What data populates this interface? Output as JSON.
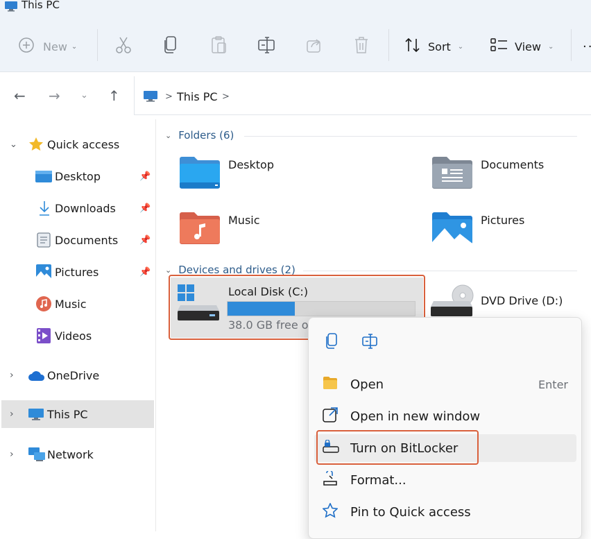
{
  "window": {
    "title": "This PC"
  },
  "toolbar": {
    "new_label": "New",
    "sort_label": "Sort",
    "view_label": "View",
    "icons": [
      "plus-circle-icon",
      "cut-icon",
      "copy-icon",
      "paste-icon",
      "rename-icon",
      "share-icon",
      "delete-icon",
      "sort-icon",
      "view-icon",
      "more-icon"
    ]
  },
  "address": {
    "crumbs": [
      "This PC"
    ],
    "separator": ">"
  },
  "sidebar": {
    "quick_access": "Quick access",
    "items": [
      {
        "label": "Desktop",
        "icon": "desktop-icon"
      },
      {
        "label": "Downloads",
        "icon": "download-icon"
      },
      {
        "label": "Documents",
        "icon": "documents-icon"
      },
      {
        "label": "Pictures",
        "icon": "pictures-icon"
      },
      {
        "label": "Music",
        "icon": "music-icon"
      },
      {
        "label": "Videos",
        "icon": "videos-icon"
      }
    ],
    "onedrive": "OneDrive",
    "this_pc": "This PC",
    "network": "Network"
  },
  "main": {
    "folders_header": "Folders (6)",
    "folders": [
      "Desktop",
      "Documents",
      "Music",
      "Pictures"
    ],
    "drives_header": "Devices and drives (2)",
    "drive_c": {
      "name": "Local Disk (C:)",
      "free_text": "38.0 GB free of",
      "used_fraction": 0.36
    },
    "drive_d": {
      "name": "DVD Drive (D:)"
    }
  },
  "context_menu": {
    "items": [
      {
        "label": "Open",
        "shortcut": "Enter",
        "icon": "folder-open-icon"
      },
      {
        "label": "Open in new window",
        "icon": "new-window-icon"
      },
      {
        "label": "Turn on BitLocker",
        "icon": "bitlocker-icon"
      },
      {
        "label": "Format...",
        "icon": "format-icon"
      },
      {
        "label": "Pin to Quick access",
        "icon": "star-icon"
      }
    ]
  },
  "colors": {
    "accent": "#2f8bd9",
    "highlight": "#d9603c",
    "selection": "#e3e3e3"
  }
}
